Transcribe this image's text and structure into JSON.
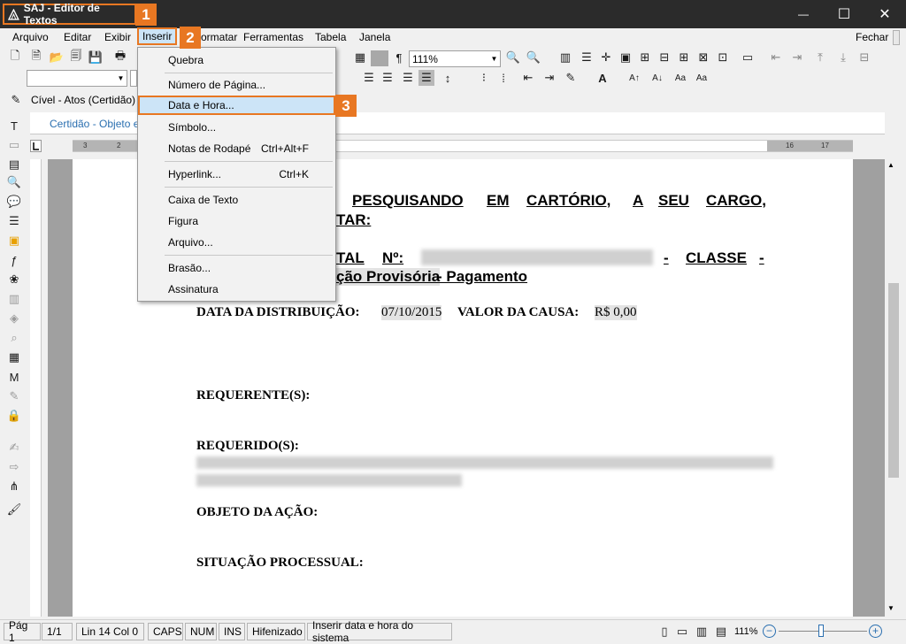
{
  "window": {
    "title": "SAJ - Editor de Textos",
    "minimize": "—",
    "maximize": "☐",
    "close": "✕"
  },
  "callouts": [
    "1",
    "2",
    "3"
  ],
  "menubar": {
    "items": [
      "Arquivo",
      "Editar",
      "Exibir",
      "Inserir",
      "ormatar",
      "Ferramentas",
      "Tabela",
      "Janela"
    ],
    "right_label": "Fechar"
  },
  "toolbar": {
    "zoom_value": "111%",
    "paragraph_mark": "¶"
  },
  "tabs": {
    "model_tab": "Cível - Atos (Certidão)",
    "doc_tab": "Certidão - Objeto e"
  },
  "ruler": {
    "labels": [
      "3",
      "2",
      "1",
      "16",
      "17"
    ]
  },
  "insert_menu": {
    "items": [
      {
        "label": "Quebra",
        "shortcut": ""
      },
      {
        "label": "Número de Página...",
        "shortcut": ""
      },
      {
        "label": "Data e Hora...",
        "shortcut": ""
      },
      {
        "label": "Símbolo...",
        "shortcut": ""
      },
      {
        "label": "Notas de Rodapé",
        "shortcut": "Ctrl+Alt+F"
      },
      {
        "label": "Hyperlink...",
        "shortcut": "Ctrl+K"
      },
      {
        "label": "Caixa de Texto",
        "shortcut": ""
      },
      {
        "label": "Figura",
        "shortcut": ""
      },
      {
        "label": "Arquivo...",
        "shortcut": ""
      },
      {
        "label": "Brasão...",
        "shortcut": ""
      },
      {
        "label": "Assinatura",
        "shortcut": ""
      }
    ]
  },
  "document": {
    "line1_a": "PESQUISANDO",
    "line1_b": "EM",
    "line1_c": "CARTÓRIO,",
    "line1_d": "A",
    "line1_e": "SEU",
    "line1_f": "CARGO,",
    "line2": "TAR:",
    "line3_a": "TAL",
    "line3_b": "Nº:",
    "line3_c": "-",
    "line3_d": "CLASSE",
    "line3_e": "-",
    "line4_a": "ção Provisória",
    "line4_b": " - Pagamento",
    "dist_label": "DATA DA DISTRIBUIÇÃO:",
    "dist_value": "07/10/2015",
    "causa_label": "VALOR DA CAUSA:",
    "causa_value": "R$ 0,00",
    "requerente": "REQUERENTE(S):",
    "requerido": "REQUERIDO(S):",
    "objeto": "OBJETO DA AÇÃO:",
    "situacao": "SITUAÇÃO PROCESSUAL:"
  },
  "statusbar": {
    "page": "Pág 1",
    "pages": "1/1",
    "position": "Lin 14  Col 0",
    "caps": "CAPS",
    "num": "NUM",
    "ins": "INS",
    "hyphen": "Hifenizado",
    "hint": "Inserir data e hora do sistema",
    "zoom": "111%"
  },
  "colors": {
    "accent": "#e87722",
    "selection": "#cce4f7",
    "titlebar": "#2b2b2b"
  }
}
